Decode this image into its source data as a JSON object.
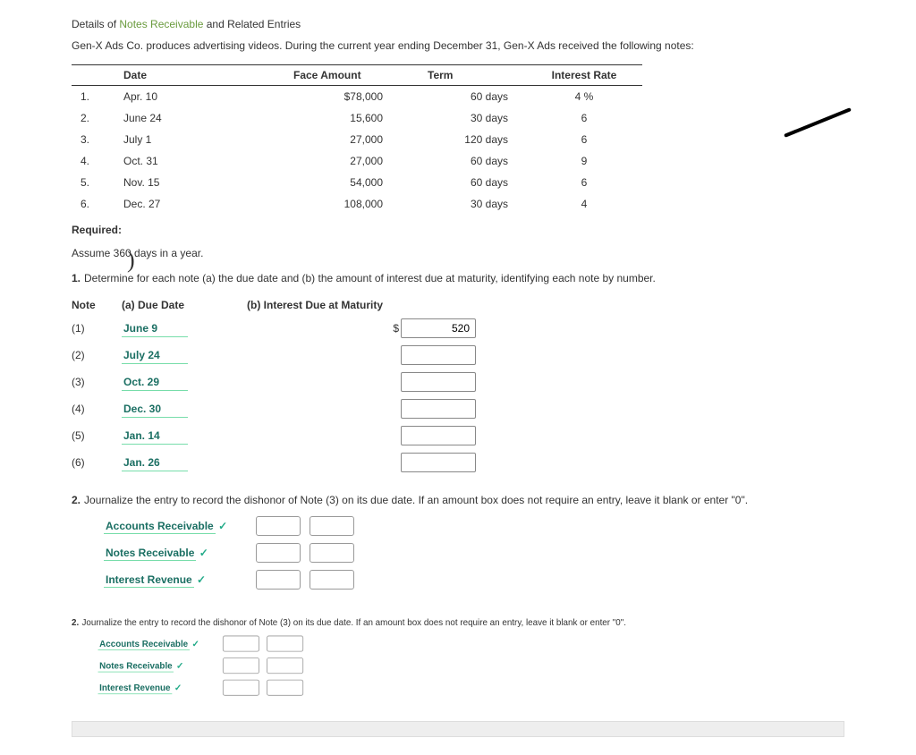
{
  "title": {
    "prefix": "Details of ",
    "link": "Notes Receivable",
    "suffix": " and Related Entries"
  },
  "intro": "Gen-X Ads Co. produces advertising videos. During the current year ending December 31, Gen-X Ads received the following notes:",
  "notes_header": {
    "date": "Date",
    "face": "Face Amount",
    "term": "Term",
    "rate": "Interest Rate"
  },
  "notes": [
    {
      "n": "1.",
      "date": "Apr. 10",
      "face": "$78,000",
      "term": "60 days",
      "rate": "4 %"
    },
    {
      "n": "2.",
      "date": "June 24",
      "face": "15,600",
      "term": "30 days",
      "rate": "6"
    },
    {
      "n": "3.",
      "date": "July 1",
      "face": "27,000",
      "term": "120 days",
      "rate": "6"
    },
    {
      "n": "4.",
      "date": "Oct. 31",
      "face": "27,000",
      "term": "60 days",
      "rate": "9"
    },
    {
      "n": "5.",
      "date": "Nov. 15",
      "face": "54,000",
      "term": "60 days",
      "rate": "6"
    },
    {
      "n": "6.",
      "date": "Dec. 27",
      "face": "108,000",
      "term": "30 days",
      "rate": "4"
    }
  ],
  "required_label": "Required:",
  "assume": "Assume 360 days in a year.",
  "q1": {
    "num": "1.",
    "text": "Determine for each note (a) the due date and (b) the amount of interest due at maturity, identifying each note by number."
  },
  "answers_header": {
    "note": "Note",
    "due": "(a) Due Date",
    "int": "(b) Interest Due at Maturity"
  },
  "answers": [
    {
      "n": "(1)",
      "due": "June 9",
      "val": "520"
    },
    {
      "n": "(2)",
      "due": "July 24",
      "val": ""
    },
    {
      "n": "(3)",
      "due": "Oct. 29",
      "val": ""
    },
    {
      "n": "(4)",
      "due": "Dec. 30",
      "val": ""
    },
    {
      "n": "(5)",
      "due": "Jan. 14",
      "val": ""
    },
    {
      "n": "(6)",
      "due": "Jan. 26",
      "val": ""
    }
  ],
  "dollar_sign": "$",
  "q2": {
    "num": "2.",
    "text": "Journalize the entry to record the dishonor of Note (3) on its due date. If an amount box does not require an entry, leave it blank or enter \"0\"."
  },
  "journal_accounts": [
    "Accounts Receivable",
    "Notes Receivable",
    "Interest Revenue"
  ],
  "checkmark": "✓"
}
